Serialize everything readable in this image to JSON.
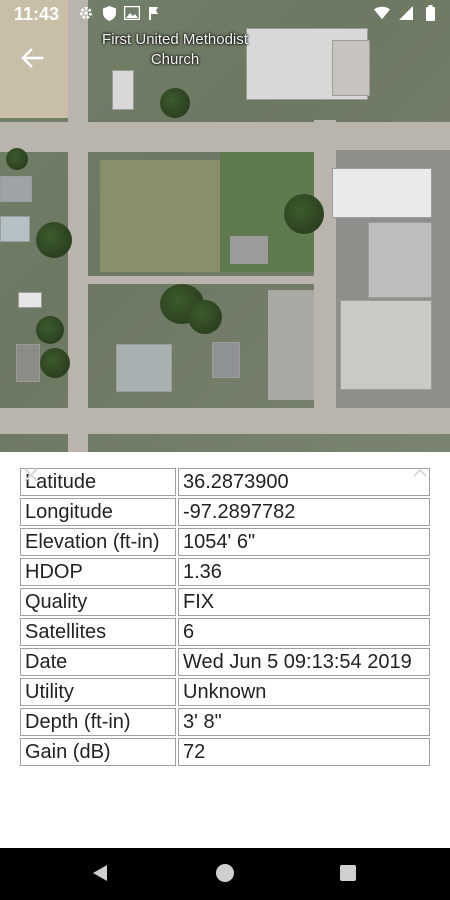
{
  "status_bar": {
    "time": "11:43",
    "left_icons": [
      "gear-icon",
      "shield-icon",
      "image-icon",
      "flag-icon"
    ],
    "right_icons": [
      "wifi-icon",
      "signal-icon",
      "battery-icon"
    ]
  },
  "map": {
    "place_label": "First United Methodist Church"
  },
  "info_table": {
    "rows": [
      {
        "label": "Latitude",
        "value": "36.2873900"
      },
      {
        "label": "Longitude",
        "value": "-97.2897782"
      },
      {
        "label": "Elevation (ft-in)",
        "value": "1054' 6\""
      },
      {
        "label": "HDOP",
        "value": "1.36"
      },
      {
        "label": "Quality",
        "value": "FIX"
      },
      {
        "label": "Satellites",
        "value": "6"
      },
      {
        "label": "Date",
        "value": "Wed Jun 5 09:13:54 2019"
      },
      {
        "label": "Utility",
        "value": "Unknown"
      },
      {
        "label": "Depth (ft-in)",
        "value": "3' 8\""
      },
      {
        "label": "Gain (dB)",
        "value": "72"
      }
    ]
  },
  "colors": {
    "panel_bg": "#ffffff",
    "cell_border": "#a0a0a0",
    "navbar_bg": "#000000"
  }
}
